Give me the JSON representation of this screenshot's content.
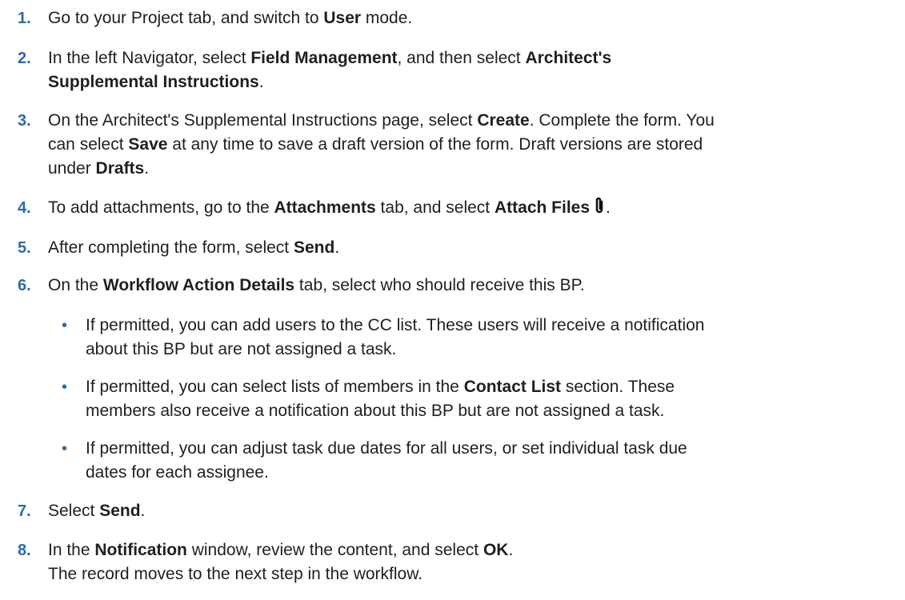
{
  "steps": [
    {
      "num": "1.",
      "parts": [
        "Go to your Project tab, and switch to ",
        "User",
        " mode."
      ]
    },
    {
      "num": "2.",
      "parts": [
        "In the left Navigator, select ",
        "Field Management",
        ", and then select ",
        "Architect's",
        "Supplemental Instructions",
        "."
      ]
    },
    {
      "num": "3.",
      "lines": [
        [
          "On the Architect's Supplemental Instructions page, select ",
          "Create",
          ". Complete the form. You"
        ],
        [
          "can select ",
          "Save",
          " at any time to save a draft version of the form. Draft versions are stored"
        ],
        [
          "under ",
          "Drafts",
          "."
        ]
      ]
    },
    {
      "num": "4.",
      "parts": [
        "To add attachments, go to the ",
        "Attachments",
        " tab, and select ",
        "Attach Files",
        "."
      ]
    },
    {
      "num": "5.",
      "parts": [
        "After completing the form, select ",
        "Send",
        "."
      ]
    },
    {
      "num": "6.",
      "parts": [
        "On the ",
        "Workflow Action Details",
        " tab, select who should receive this BP."
      ]
    },
    {
      "num": "7.",
      "parts": [
        "Select ",
        "Send",
        "."
      ]
    },
    {
      "num": "8.",
      "parts": [
        "In the ",
        "Notification",
        " window, review the content, and select ",
        "OK",
        "."
      ],
      "note": "The record moves to the next step in the workflow."
    }
  ],
  "substeps": [
    {
      "bullet": "•",
      "line1": "If permitted, you can add users to the CC list. These users will receive a notification",
      "line2": "about this BP but are not assigned a task."
    },
    {
      "bullet": "•",
      "line1a": "If permitted, you can select lists of members in the ",
      "line1b": "Contact List",
      "line1c": " section. These",
      "line2": "members also receive a notification about this BP but are not assigned a task."
    },
    {
      "bullet": "•",
      "line1": "If permitted, you can adjust task due dates for all users, or set individual task due",
      "line2": "dates for each assignee."
    }
  ],
  "icons": {
    "attach": "paperclip-icon"
  }
}
